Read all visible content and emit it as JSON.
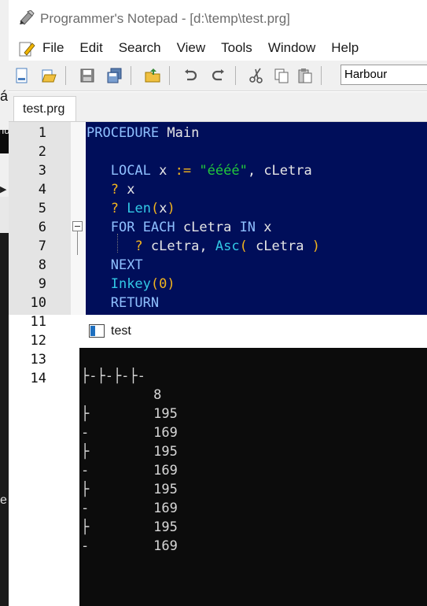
{
  "window": {
    "title": "Programmer's Notepad - [d:\\temp\\test.prg]"
  },
  "menu": [
    "File",
    "Edit",
    "Search",
    "View",
    "Tools",
    "Window",
    "Help"
  ],
  "toolbar": {
    "buttons": [
      "new-file",
      "open-file",
      "save",
      "save-all",
      "open-project",
      "undo",
      "redo",
      "cut",
      "copy",
      "paste"
    ],
    "language": "Harbour"
  },
  "tab": {
    "label": "test.prg"
  },
  "editor": {
    "line_numbers": [
      "1",
      "2",
      "3",
      "4",
      "5",
      "6",
      "7",
      "8",
      "9",
      "10",
      "11",
      "12",
      "13",
      "14"
    ],
    "lines": [
      {
        "text": "PROCEDURE Main"
      },
      {
        "text": ""
      },
      {
        "text": "   LOCAL x := \"éééé\", cLetra"
      },
      {
        "text": "   ? x"
      },
      {
        "text": "   ? Len(x)"
      },
      {
        "text": "   FOR EACH cLetra IN x"
      },
      {
        "text": "      ? cLetra, Asc( cLetra )"
      },
      {
        "text": "   NEXT"
      },
      {
        "text": "   Inkey(0)"
      },
      {
        "text": "   RETURN"
      }
    ]
  },
  "console": {
    "title": "test",
    "output": [
      "├-├-├-├-",
      "         8",
      "├        195",
      "-        169",
      "├        195",
      "-        169",
      "├        195",
      "-        169",
      "├        195",
      "-        169"
    ]
  },
  "colors": {
    "editor_bg": "#000e5a",
    "keyword": "#8fc0ff",
    "string": "#22c93b",
    "operator": "#f3b51d",
    "function": "#32c9e6",
    "console_bg": "#0c0c0c"
  }
}
